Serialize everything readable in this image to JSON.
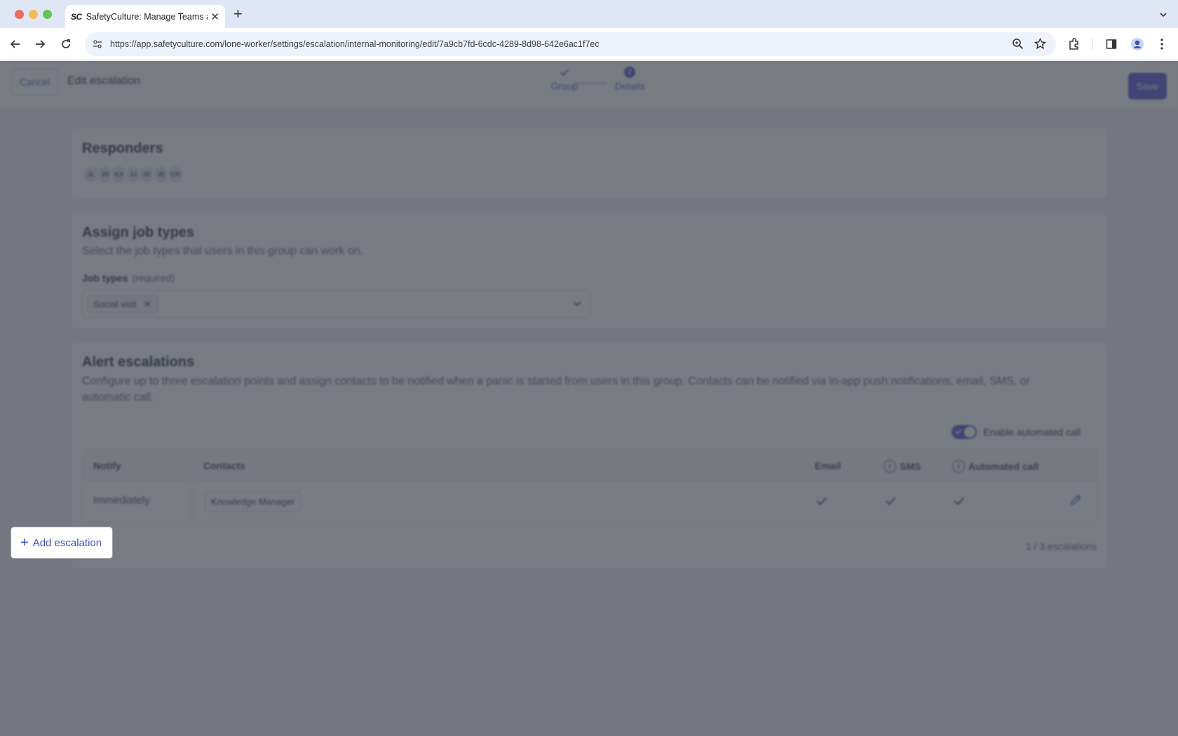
{
  "browser": {
    "tab_title": "SafetyCulture: Manage Teams and...",
    "tab_logo": "SC",
    "url": "https://app.safetyculture.com/lone-worker/settings/escalation/internal-monitoring/edit/7a9cb7fd-6cdc-4289-8d98-642e6ac1f7ec"
  },
  "header": {
    "cancel_label": "Cancel",
    "title": "Edit escalation",
    "save_label": "Save",
    "steps": [
      {
        "label": "Group",
        "state": "complete"
      },
      {
        "label": "Details",
        "state": "current",
        "number": "2"
      }
    ]
  },
  "responders": {
    "title": "Responders",
    "avatars": [
      "JL",
      "JH",
      "KA",
      "JJ",
      "JC",
      "JE",
      "CH"
    ]
  },
  "job_types": {
    "title": "Assign job types",
    "description": "Select the job types that users in this group can work on.",
    "field_label": "Job types",
    "field_required": "(required)",
    "selected": [
      "Social visit"
    ]
  },
  "alert_escalations": {
    "title": "Alert escalations",
    "description": "Configure up to three escalation points and assign contacts to be notified when a panic is started from users in this group. Contacts can be notified via in-app push notifications, email, SMS, or automatic call.",
    "toggle_label": "Enable automated call",
    "toggle_on": true,
    "columns": {
      "notify": "Notify",
      "contacts": "Contacts",
      "email": "Email",
      "sms": "SMS",
      "call": "Automated call"
    },
    "rows": [
      {
        "notify": "Immediately",
        "contact": "Knowledge Manager",
        "email": true,
        "sms": true,
        "call": true
      }
    ],
    "add_label": "Add escalation",
    "count_label": "1 / 3 escalations"
  },
  "colors": {
    "accent": "#4a4ed4",
    "link": "#3d4fcf",
    "overlay": "rgba(60,64,72,0.69)"
  },
  "icons": [
    "back-icon",
    "forward-icon",
    "reload-icon",
    "site-info-icon",
    "zoom-icon",
    "star-icon",
    "extensions-icon",
    "side-panel-icon",
    "profile-icon",
    "menu-icon",
    "chevron-down-icon",
    "check-icon",
    "info-icon",
    "pencil-icon",
    "plus-icon",
    "close-icon"
  ]
}
